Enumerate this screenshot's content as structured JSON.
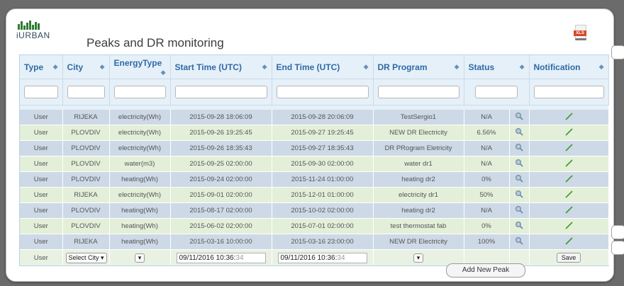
{
  "app": {
    "logo_text": "iURBAN",
    "page_title": "Peaks and DR monitoring",
    "export_icon": "xls-file-icon"
  },
  "table": {
    "columns": [
      "Type",
      "City",
      "EnergyType",
      "Start Time (UTC)",
      "End Time (UTC)",
      "DR Program",
      "Status",
      "Notification"
    ],
    "rows": [
      {
        "type": "User",
        "city": "RIJEKA",
        "energy": "electricity(Wh)",
        "start": "2015-09-28 18:06:09",
        "end": "2015-09-28 20:06:09",
        "program": "TestSergio1",
        "status": "N/A"
      },
      {
        "type": "User",
        "city": "PLOVDIV",
        "energy": "electricity(Wh)",
        "start": "2015-09-26 19:25:45",
        "end": "2015-09-27 19:25:45",
        "program": "NEW DR Electricity",
        "status": "6.56%"
      },
      {
        "type": "User",
        "city": "PLOVDIV",
        "energy": "electricity(Wh)",
        "start": "2015-09-26 18:35:43",
        "end": "2015-09-27 18:35:43",
        "program": "DR PRogram Eletricity",
        "status": "N/A"
      },
      {
        "type": "User",
        "city": "PLOVDIV",
        "energy": "water(m3)",
        "start": "2015-09-25 02:00:00",
        "end": "2015-09-30 02:00:00",
        "program": "water dr1",
        "status": "N/A"
      },
      {
        "type": "User",
        "city": "PLOVDIV",
        "energy": "heating(Wh)",
        "start": "2015-09-24 02:00:00",
        "end": "2015-11-24 01:00:00",
        "program": "heating dr2",
        "status": "0%"
      },
      {
        "type": "User",
        "city": "RIJEKA",
        "energy": "electricity(Wh)",
        "start": "2015-09-01 02:00:00",
        "end": "2015-12-01 01:00:00",
        "program": "electricity dr1",
        "status": "50%"
      },
      {
        "type": "User",
        "city": "PLOVDIV",
        "energy": "heating(Wh)",
        "start": "2015-08-17 02:00:00",
        "end": "2015-10-02 02:00:00",
        "program": "heating dr2",
        "status": "N/A"
      },
      {
        "type": "User",
        "city": "PLOVDIV",
        "energy": "heating(Wh)",
        "start": "2015-06-02 02:00:00",
        "end": "2015-07-01 02:00:00",
        "program": "test thermostat fab",
        "status": "0%"
      },
      {
        "type": "User",
        "city": "RIJEKA",
        "energy": "heating(Wh)",
        "start": "2015-03-16 10:00:00",
        "end": "2015-03-16 23:00:00",
        "program": "NEW DR Electricity",
        "status": "100%"
      }
    ],
    "new_row": {
      "type": "User",
      "city_select": "Select City",
      "start_value": "09/11/2016 10:36:",
      "start_seconds": "34",
      "end_value": "09/11/2016 10:36:",
      "end_seconds": "34",
      "save_label": "Save"
    }
  },
  "add_new_peak_label": "Add New Peak"
}
